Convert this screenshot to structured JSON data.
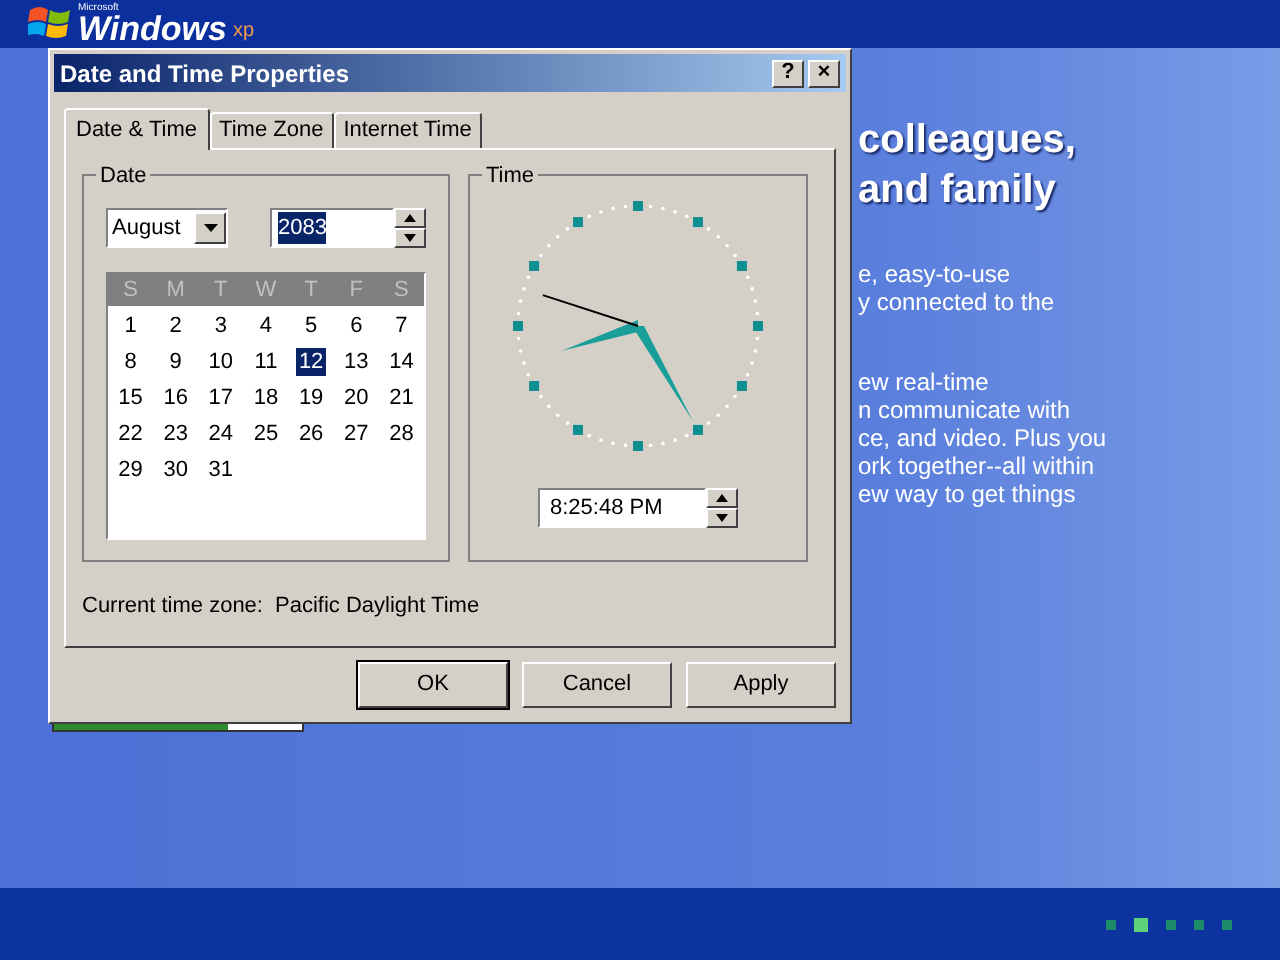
{
  "logo": {
    "small": "Microsoft",
    "name": "Windows",
    "suffix": "xp"
  },
  "background_text": {
    "heading": [
      "colleagues,",
      "and family"
    ],
    "paragraph_1": [
      "e, easy-to-use",
      "y connected to the"
    ],
    "paragraph_2": [
      "ew real-time",
      "n communicate with",
      "ce, and video. Plus you",
      "ork together--all within",
      "ew way to get things"
    ]
  },
  "progress": {
    "level": 0.7
  },
  "dialog": {
    "title": "Date and Time Properties",
    "title_buttons": [
      "?",
      "×"
    ],
    "tabs": [
      {
        "label": "Date & Time",
        "selected": true
      },
      {
        "label": "Time Zone",
        "selected": false
      },
      {
        "label": "Internet Time",
        "selected": false
      }
    ],
    "date_group": {
      "label": "Date",
      "month": "August",
      "year": "2083",
      "weekdays": [
        "S",
        "M",
        "T",
        "W",
        "T",
        "F",
        "S"
      ],
      "days": [
        {
          "label": "1",
          "selected": false
        },
        {
          "label": "2",
          "selected": false
        },
        {
          "label": "3",
          "selected": false
        },
        {
          "label": "4",
          "selected": false
        },
        {
          "label": "5",
          "selected": false
        },
        {
          "label": "6",
          "selected": false
        },
        {
          "label": "7",
          "selected": false
        },
        {
          "label": "8",
          "selected": false
        },
        {
          "label": "9",
          "selected": false
        },
        {
          "label": "10",
          "selected": false
        },
        {
          "label": "11",
          "selected": false
        },
        {
          "label": "12",
          "selected": true
        },
        {
          "label": "13",
          "selected": false
        },
        {
          "label": "14",
          "selected": false
        },
        {
          "label": "15",
          "selected": false
        },
        {
          "label": "16",
          "selected": false
        },
        {
          "label": "17",
          "selected": false
        },
        {
          "label": "18",
          "selected": false
        },
        {
          "label": "19",
          "selected": false
        },
        {
          "label": "20",
          "selected": false
        },
        {
          "label": "21",
          "selected": false
        },
        {
          "label": "22",
          "selected": false
        },
        {
          "label": "23",
          "selected": false
        },
        {
          "label": "24",
          "selected": false
        },
        {
          "label": "25",
          "selected": false
        },
        {
          "label": "26",
          "selected": false
        },
        {
          "label": "27",
          "selected": false
        },
        {
          "label": "28",
          "selected": false
        },
        {
          "label": "29",
          "selected": false
        },
        {
          "label": "30",
          "selected": false
        },
        {
          "label": "31",
          "selected": false
        }
      ]
    },
    "time_group": {
      "label": "Time",
      "time": "8:25:48 PM"
    },
    "time_zone_label": "Current time zone:",
    "time_zone": "Pacific Daylight Time",
    "buttons": [
      "OK",
      "Cancel",
      "Apply"
    ]
  },
  "pager": [
    {
      "selected": false
    },
    {
      "selected": true
    },
    {
      "selected": false
    },
    {
      "selected": false
    },
    {
      "selected": false
    }
  ]
}
